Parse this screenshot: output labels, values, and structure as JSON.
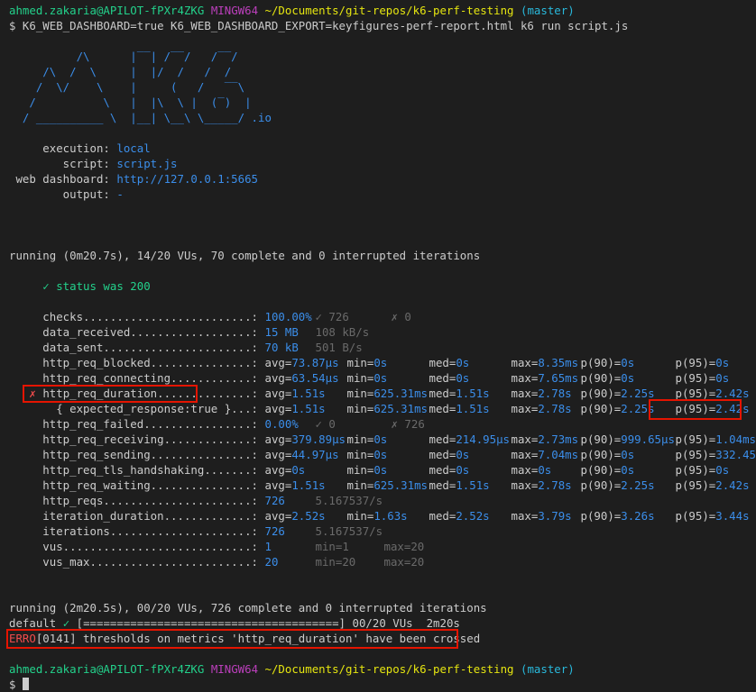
{
  "prompt1": {
    "user_host": "ahmed.zakaria@APILOT-fPXr4ZKG",
    "shell": "MINGW64",
    "path": "~/Documents/git-repos/k6-perf-testing",
    "branch": "(master)"
  },
  "command": "$ K6_WEB_DASHBOARD=true K6_WEB_DASHBOARD_EXPORT=keyfigures-perf-report.html k6 run script.js",
  "logo": [
    "          /\\      |‾‾| /‾‾/   /‾‾/",
    "     /\\  /  \\     |  |/  /   /  /",
    "    /  \\/    \\    |     (   /   ‾‾\\",
    "   /          \\   |  |\\  \\ |  (‾)  |",
    "  / __________ \\  |__| \\__\\ \\_____/ .io"
  ],
  "info": [
    {
      "key": "     execution: ",
      "value": "local"
    },
    {
      "key": "        script: ",
      "value": "script.js"
    },
    {
      "key": " web dashboard: ",
      "value": "http://127.0.0.1:5665"
    },
    {
      "key": "        output: ",
      "value": "-"
    }
  ],
  "running1": "running (0m20.7s), 14/20 VUs, 70 complete and 0 interrupted iterations",
  "check_line": "     ✓ status was 200",
  "metrics": {
    "checks": {
      "label": "     checks.........................: ",
      "value": "100.00%",
      "pass": "✓ 726",
      "fail": "✗ 0"
    },
    "data_received": {
      "label": "     data_received..................: ",
      "value": "15 MB",
      "rate": "108 kB/s"
    },
    "data_sent": {
      "label": "     data_sent......................: ",
      "value": "70 kB",
      "rate": "501 B/s"
    },
    "http_req_blocked": {
      "label": "     http_req_blocked...............: ",
      "avg": "73.87µs",
      "min": "0s",
      "med": "0s",
      "max": "8.35ms",
      "p90": "0s",
      "p95": "0s"
    },
    "http_req_connecting": {
      "label": "     http_req_connecting............: ",
      "avg": "63.54µs",
      "min": "0s",
      "med": "0s",
      "max": "7.65ms",
      "p90": "0s",
      "p95": "0s"
    },
    "http_req_duration": {
      "mark": "   ✗ ",
      "label": "http_req_duration..............: ",
      "avg": "1.51s",
      "min": "625.31ms",
      "med": "1.51s",
      "max": "2.78s",
      "p90": "2.25s",
      "p95": "2.42s"
    },
    "expected_response": {
      "label": "       { expected_response:true }...: ",
      "avg": "1.51s",
      "min": "625.31ms",
      "med": "1.51s",
      "max": "2.78s",
      "p90": "2.25s",
      "p95": "2.42s"
    },
    "http_req_failed": {
      "label": "     http_req_failed................: ",
      "value": "0.00%",
      "pass": "✓ 0",
      "fail": "✗ 726"
    },
    "http_req_receiving": {
      "label": "     http_req_receiving.............: ",
      "avg": "379.89µs",
      "min": "0s",
      "med": "214.95µs",
      "max": "2.73ms",
      "p90": "999.65µs",
      "p95": "1.04ms"
    },
    "http_req_sending": {
      "label": "     http_req_sending...............: ",
      "avg": "44.97µs",
      "min": "0s",
      "med": "0s",
      "max": "7.04ms",
      "p90": "0s",
      "p95": "332.45µs"
    },
    "http_req_tls_handshaking": {
      "label": "     http_req_tls_handshaking.......: ",
      "avg": "0s",
      "min": "0s",
      "med": "0s",
      "max": "0s",
      "p90": "0s",
      "p95": "0s"
    },
    "http_req_waiting": {
      "label": "     http_req_waiting...............: ",
      "avg": "1.51s",
      "min": "625.31ms",
      "med": "1.51s",
      "max": "2.78s",
      "p90": "2.25s",
      "p95": "2.42s"
    },
    "http_reqs": {
      "label": "     http_reqs......................: ",
      "value": "726",
      "rate": "5.167537/s"
    },
    "iteration_duration": {
      "label": "     iteration_duration.............: ",
      "avg": "2.52s",
      "min": "1.63s",
      "med": "2.52s",
      "max": "3.79s",
      "p90": "3.26s",
      "p95": "3.44s"
    },
    "iterations": {
      "label": "     iterations.....................: ",
      "value": "726",
      "rate": "5.167537/s"
    },
    "vus": {
      "label": "     vus............................: ",
      "value": "1",
      "min": "min=1",
      "max": "max=20"
    },
    "vus_max": {
      "label": "     vus_max........................: ",
      "value": "20",
      "min": "min=20",
      "max": "max=20"
    }
  },
  "stat_keys": {
    "avg": "avg=",
    "min": "min=",
    "med": "med=",
    "max": "max=",
    "p90": "p(90)=",
    "p95": "p(95)="
  },
  "running2": "running (2m20.5s), 00/20 VUs, 726 complete and 0 interrupted iterations",
  "progress": {
    "scenario": "default",
    "check": "✓",
    "bar": "[======================================]",
    "vus": "00/20 VUs",
    "elapsed": "2m20s",
    "fraction": 1.0
  },
  "error": {
    "level": "ERRO",
    "text": "[0141] thresholds on metrics 'http_req_duration' have been crossed"
  },
  "prompt2": {
    "user_host": "ahmed.zakaria@APILOT-fPXr4ZKG",
    "shell": "MINGW64",
    "path": "~/Documents/git-repos/k6-perf-testing",
    "branch": "(master)"
  },
  "final_prompt": "$",
  "highlight_color": "#e51400"
}
